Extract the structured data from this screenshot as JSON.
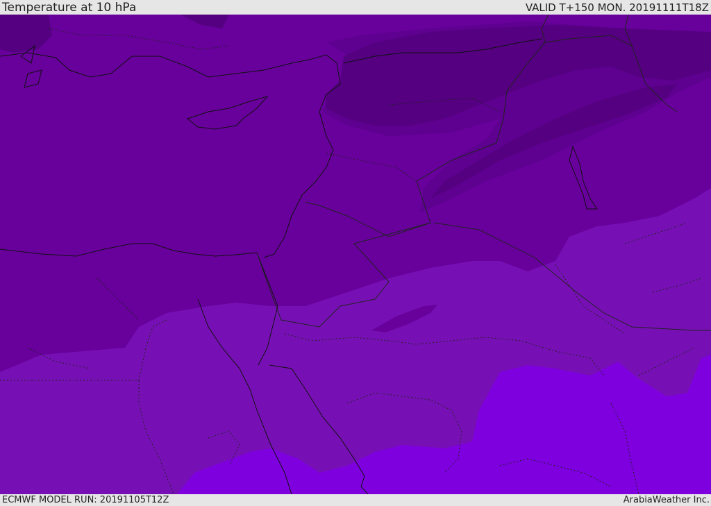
{
  "header": {
    "title": "Temperature at 10 hPa",
    "valid": "VALID T+150 MON. 20191111T18Z"
  },
  "footer": {
    "model_run": "ECMWF MODEL RUN: 20191105T12Z",
    "credit": "ArabiaWeather Inc."
  },
  "colors": {
    "band_darkest": "#540080",
    "band_dark": "#5e0090",
    "band_mid": "#68009c",
    "band_light": "#7710b4",
    "band_bright": "#7e00de",
    "coastline": "#111111",
    "border": "#222222",
    "background": "#e6e6e6"
  }
}
